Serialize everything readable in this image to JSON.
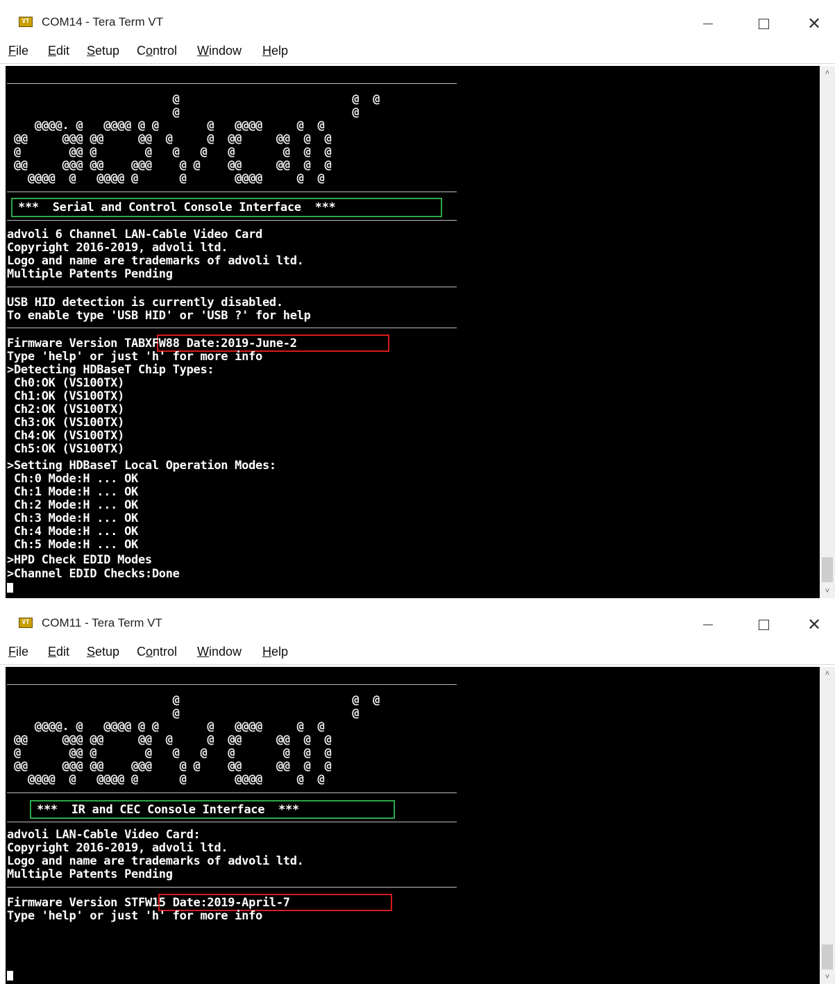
{
  "windows": [
    {
      "title": "COM14 - Tera Term VT",
      "app_icon": "VT",
      "controls": {
        "minimize": "—",
        "maximize": "☐",
        "close": "✕"
      },
      "menu": [
        "File",
        "Edit",
        "Setup",
        "Control",
        "Window",
        "Help"
      ],
      "menu_mnemonics": [
        "F",
        "E",
        "S",
        "o",
        "W",
        "H"
      ],
      "logo": [
        "                        @                         @  @",
        "                        @                         @",
        "    @@@@. @   @@@@ @ @       @   @@@@     @  @",
        " @@     @@@ @@     @@  @     @  @@     @@  @  @",
        " @       @@ @       @   @   @   @       @  @  @",
        " @@     @@@ @@    @@@    @ @    @@     @@  @  @",
        "   @@@@  @   @@@@ @      @       @@@@     @  @"
      ],
      "banner": "***  Serial and Control Console Interface  ***",
      "info": [
        "advoli 6 Channel LAN-Cable Video Card",
        "Copyright 2016-2019, advoli ltd.",
        "Logo and name are trademarks of advoli ltd.",
        "Multiple Patents Pending"
      ],
      "usb": [
        "USB HID detection is currently disabled.",
        "To enable type 'USB HID' or 'USB ?' for help"
      ],
      "firmware_prefix": "Firmware Version ",
      "firmware_value": "TABXFW88 Date:2019-June-2",
      "log": [
        "Type 'help' or just 'h' for more info",
        ">Detecting HDBaseT Chip Types:",
        " Ch0:OK (VS100TX)",
        " Ch1:OK (VS100TX)",
        " Ch2:OK (VS100TX)",
        " Ch3:OK (VS100TX)",
        " Ch4:OK (VS100TX)",
        " Ch5:OK (VS100TX)",
        ">Setting HDBaseT Local Operation Modes:",
        " Ch:0 Mode:H ... OK",
        " Ch:1 Mode:H ... OK",
        " Ch:2 Mode:H ... OK",
        " Ch:3 Mode:H ... OK",
        " Ch:4 Mode:H ... OK",
        " Ch:5 Mode:H ... OK",
        ">HPD Check EDID Modes",
        ">Channel EDID Checks:Done"
      ]
    },
    {
      "title": "COM11 - Tera Term VT",
      "app_icon": "VT",
      "controls": {
        "minimize": "—",
        "maximize": "☐",
        "close": "✕"
      },
      "menu": [
        "File",
        "Edit",
        "Setup",
        "Control",
        "Window",
        "Help"
      ],
      "menu_mnemonics": [
        "F",
        "E",
        "S",
        "o",
        "W",
        "H"
      ],
      "logo": [
        "                        @                         @  @",
        "                        @                         @",
        "    @@@@. @   @@@@ @ @       @   @@@@     @  @",
        " @@     @@@ @@     @@  @     @  @@     @@  @  @",
        " @       @@ @       @   @   @   @       @  @  @",
        " @@     @@@ @@    @@@    @ @    @@     @@  @  @",
        "   @@@@  @   @@@@ @      @       @@@@     @  @"
      ],
      "banner": "***  IR and CEC Console Interface  ***",
      "info": [
        "advoli LAN-Cable Video Card:",
        "Copyright 2016-2019, advoli ltd.",
        "Logo and name are trademarks of advoli ltd.",
        "Multiple Patents Pending"
      ],
      "firmware_prefix": "Firmware Version ",
      "firmware_value": "STFW15 Date:2019-April-7",
      "log": [
        "Type 'help' or just 'h' for more info"
      ]
    }
  ],
  "icons": {
    "app": "tera-term-icon",
    "minimize": "minimize-icon",
    "maximize": "maximize-icon",
    "close": "close-icon",
    "scroll_up": "scroll-up-icon",
    "scroll_down": "scroll-down-icon"
  },
  "colors": {
    "terminal_bg": "#000000",
    "terminal_fg": "#ffffff",
    "banner_highlight": "#2ea84a",
    "firmware_highlight": "#d81b1b"
  }
}
